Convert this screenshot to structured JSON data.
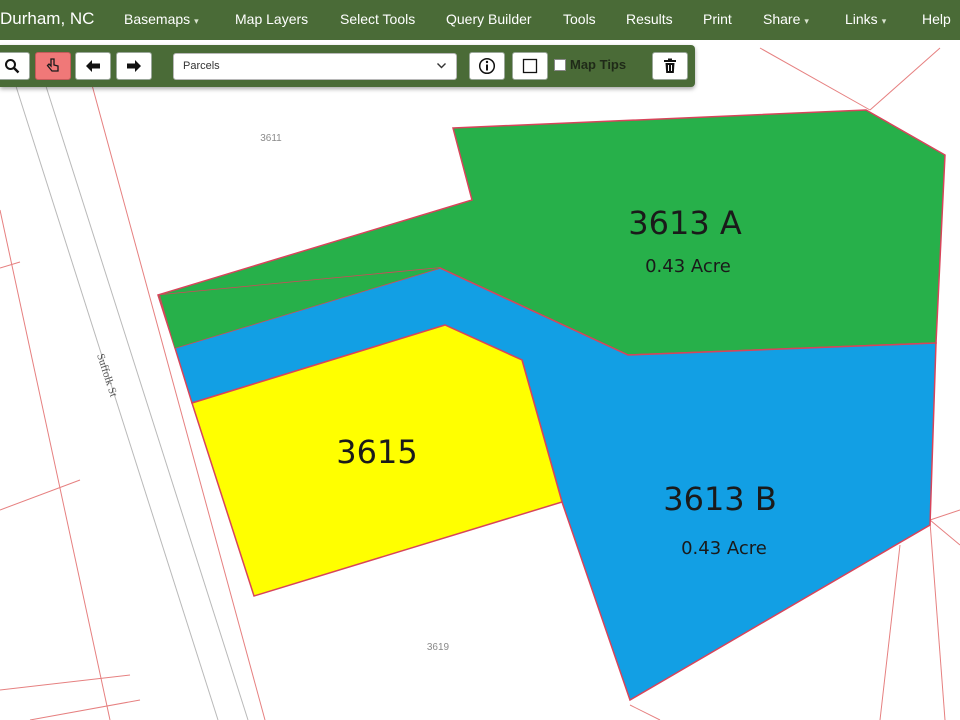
{
  "header": {
    "brand": "Durham, NC",
    "menu": [
      {
        "label": "Basemaps",
        "dropdown": true
      },
      {
        "label": "Map Layers",
        "dropdown": false
      },
      {
        "label": "Select Tools",
        "dropdown": false
      },
      {
        "label": "Query Builder",
        "dropdown": false
      },
      {
        "label": "Tools",
        "dropdown": false
      },
      {
        "label": "Results",
        "dropdown": false
      },
      {
        "label": "Print",
        "dropdown": false
      },
      {
        "label": "Share",
        "dropdown": true
      },
      {
        "label": "Links",
        "dropdown": true
      },
      {
        "label": "Help",
        "dropdown": false
      }
    ]
  },
  "toolbar": {
    "buttons": [
      {
        "icon": "zoom-icon",
        "active": false
      },
      {
        "icon": "select-pointer-icon",
        "active": true
      },
      {
        "icon": "arrow-left-icon",
        "active": false
      },
      {
        "icon": "arrow-right-icon",
        "active": false
      },
      {
        "icon": "info-icon",
        "active": false
      },
      {
        "icon": "rectangle-select-icon",
        "active": false
      },
      {
        "icon": "trash-icon",
        "active": false
      }
    ],
    "layer_select": {
      "value": "Parcels"
    },
    "map_tips": {
      "label": "Map Tips",
      "checked": false
    }
  },
  "map": {
    "street_label": "Suffolk St",
    "parcel_numbers": [
      "3611",
      "3619"
    ],
    "parcels": [
      {
        "name": "3613 A",
        "area": "0.43 Acre",
        "fill": "#27b04a"
      },
      {
        "name": "3613 B",
        "area": "0.43 Acre",
        "fill": "#129fe4"
      },
      {
        "name": "3615",
        "area": "",
        "fill": "#ffff00"
      }
    ],
    "boundary_color": "#e0555a"
  },
  "colors": {
    "nav": "#4a6b37",
    "accent_active": "#f07878"
  }
}
